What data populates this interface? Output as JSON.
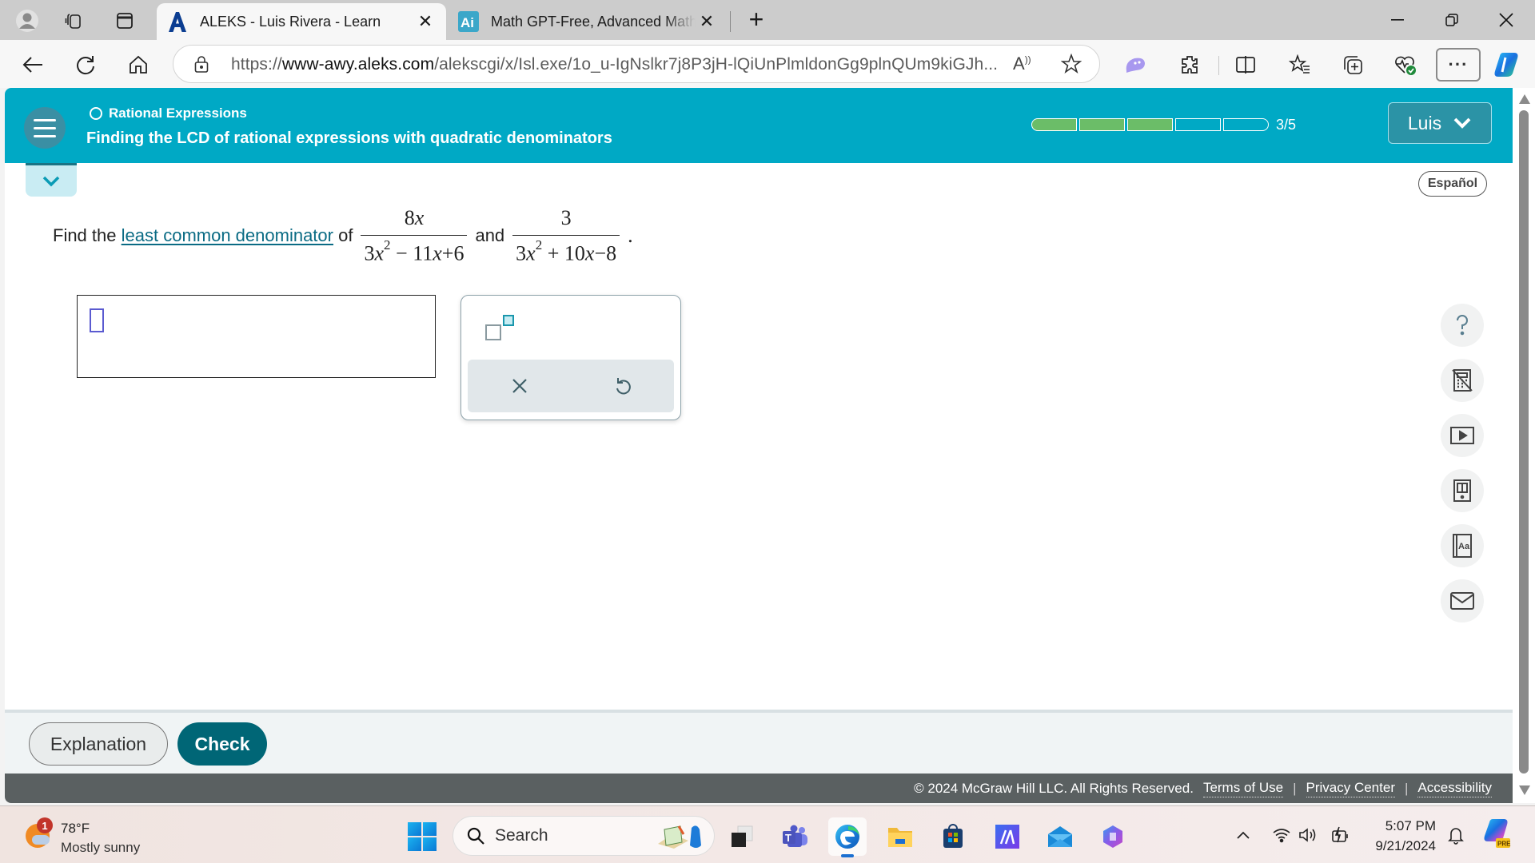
{
  "browser": {
    "tabs": [
      {
        "title": "ALEKS - Luis Rivera - Learn",
        "favicon": "aleks-logo-icon",
        "active": true
      },
      {
        "title": "Math GPT-Free, Advanced Math S",
        "favicon": "mathgpt-ai-icon",
        "active": false
      }
    ],
    "url_prefix": "https://",
    "url_host": "www-awy.aleks.com",
    "url_path": "/alekscgi/x/Isl.exe/1o_u-IgNslkr7j8P3jH-lQiUnPlmldonGg9plnQUm9kiGJh...",
    "read_aloud_label": "A҆"
  },
  "aleks": {
    "topic": "Rational Expressions",
    "lesson_title": "Finding the LCD of rational expressions with quadratic denominators",
    "progress": {
      "completed": 3,
      "total": 5,
      "label": "3/5"
    },
    "user_button": "Luis",
    "language_button": "Español",
    "question": {
      "prefix": "Find the",
      "link_text": "least common denominator",
      "of": "of",
      "and": "and",
      "period": ".",
      "fraction1": {
        "numerator_coef": "8",
        "numerator_var": "x",
        "den_a": "3",
        "den_var": "x",
        "den_exp": "2",
        "den_rest_op1": "−",
        "den_b": "11",
        "den_var2": "x",
        "den_op2": "+",
        "den_c": "6"
      },
      "fraction2": {
        "numerator": "3",
        "den_a": "3",
        "den_var": "x",
        "den_exp": "2",
        "den_rest_op1": "+",
        "den_b": "10",
        "den_var2": "x",
        "den_op2": "−",
        "den_c": "8"
      }
    },
    "answer_value": "",
    "palette": {
      "exponent_tool": "exponent-icon",
      "clear_label": "×",
      "undo_label": "undo"
    },
    "tools": [
      "help-icon",
      "calculator-disabled-icon",
      "video-icon",
      "ebook-icon",
      "dictionary-icon",
      "message-icon"
    ],
    "buttons": {
      "explanation": "Explanation",
      "check": "Check"
    },
    "footer": {
      "copyright": "© 2024 McGraw Hill LLC. All Rights Reserved.",
      "links": [
        "Terms of Use",
        "Privacy Center",
        "Accessibility"
      ],
      "separator": "|"
    },
    "colors": {
      "header": "#00a9c5",
      "progress_fill": "#6bbd68",
      "check_button": "#006676",
      "footer": "#5a6061"
    }
  },
  "taskbar": {
    "weather": {
      "temp": "78°F",
      "condition": "Mostly sunny",
      "badge": "1"
    },
    "search_label": "Search",
    "time": "5:07 PM",
    "date": "9/21/2024",
    "copilot_badge": "PRE"
  }
}
